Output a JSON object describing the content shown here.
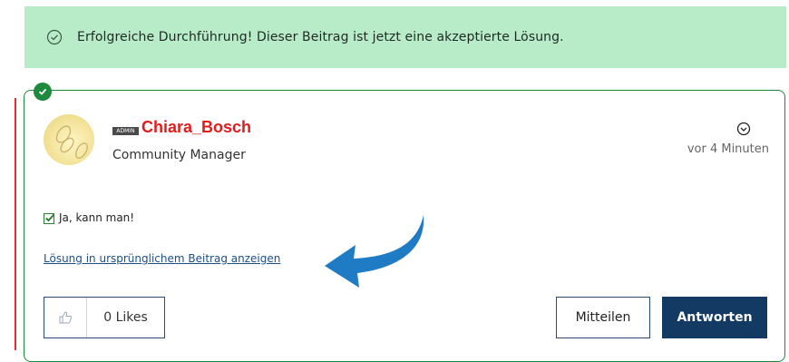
{
  "banner": {
    "message": "Erfolgreiche Durchführung! Dieser Beitrag ist jetzt eine akzeptierte Lösung.",
    "icon": "check-circle-icon"
  },
  "post": {
    "author": {
      "admin_tag": "ADMIN",
      "name": "Chiara_Bosch",
      "role": "Community Manager"
    },
    "timestamp": "vor 4 Minuten",
    "body_text": "Ja, kann man!",
    "solution_link": "Lösung in ursprünglichem Beitrag anzeigen",
    "accepted": true
  },
  "actions": {
    "likes_label": "0 Likes",
    "share_label": "Mitteilen",
    "reply_label": "Antworten"
  },
  "colors": {
    "banner_bg": "#b8ebc8",
    "accepted_border": "#1a8a3a",
    "username": "#e31b1b",
    "primary_button": "#123a63",
    "arrow": "#1f7bc4"
  }
}
